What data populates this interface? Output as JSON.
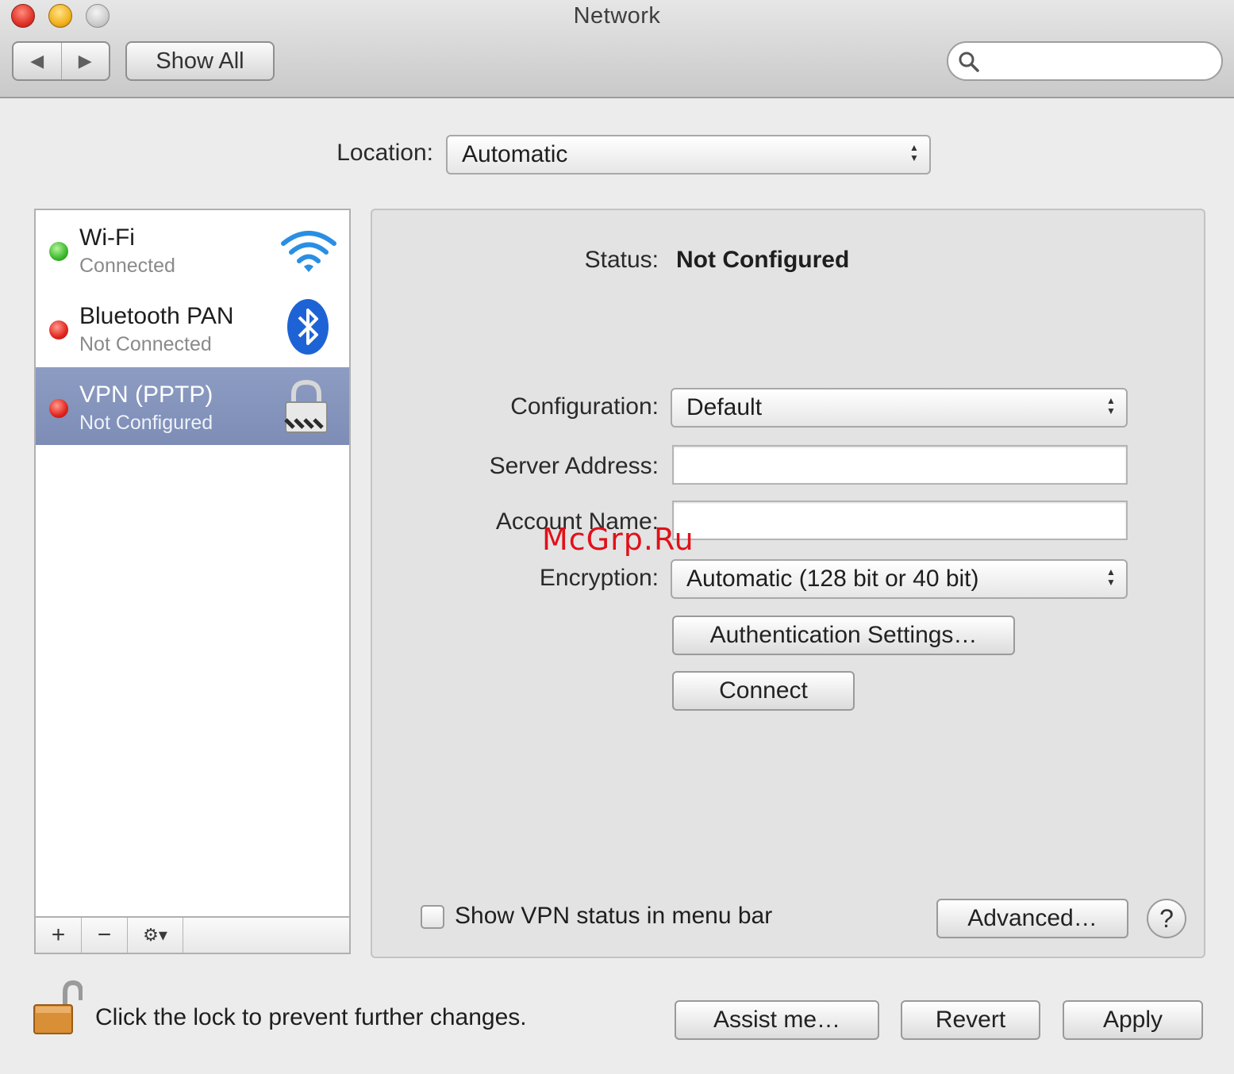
{
  "window": {
    "title": "Network",
    "show_all_label": "Show All",
    "back_glyph": "◀",
    "forward_glyph": "▶",
    "search_placeholder": ""
  },
  "location": {
    "label": "Location:",
    "value": "Automatic"
  },
  "services": [
    {
      "name": "Wi-Fi",
      "status": "Connected",
      "indicator": "green",
      "icon": "wifi-icon"
    },
    {
      "name": "Bluetooth PAN",
      "status": "Not Connected",
      "indicator": "red",
      "icon": "bluetooth-icon"
    },
    {
      "name": "VPN (PPTP)",
      "status": "Not Configured",
      "indicator": "red",
      "icon": "lock-icon",
      "selected": true
    }
  ],
  "sidebar_bar": {
    "add": "+",
    "remove": "−",
    "action": "⚙▾"
  },
  "detail": {
    "status_label": "Status:",
    "status_value": "Not Configured",
    "configuration_label": "Configuration:",
    "configuration_value": "Default",
    "server_label": "Server Address:",
    "server_value": "",
    "account_label": "Account Name:",
    "account_value": "",
    "encryption_label": "Encryption:",
    "encryption_value": "Automatic (128 bit or 40 bit)",
    "auth_button": "Authentication Settings…",
    "connect_button": "Connect",
    "show_status_label": "Show VPN status in menu bar",
    "show_status_checked": false,
    "advanced_button": "Advanced…",
    "help_glyph": "?"
  },
  "footer": {
    "lock_text": "Click the lock to prevent further changes.",
    "assist_button": "Assist me…",
    "revert_button": "Revert",
    "apply_button": "Apply"
  },
  "watermark": "McGrp.Ru",
  "colors": {
    "selection": "#8291b9",
    "connected": "#3bb72a",
    "disconnected": "#e0241c",
    "watermark": "#e0111a"
  }
}
